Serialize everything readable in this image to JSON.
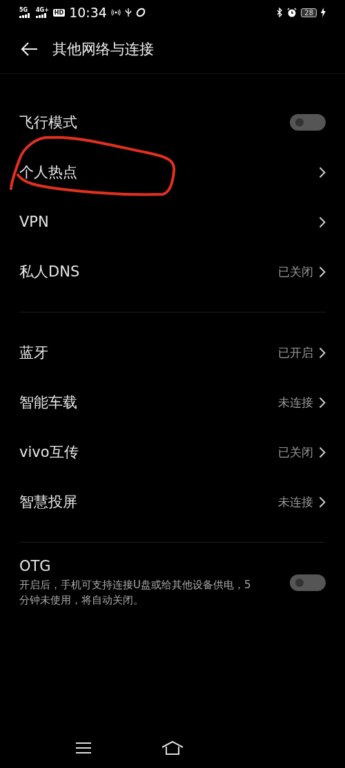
{
  "status_bar": {
    "signal_labels": [
      "5G",
      "4G+"
    ],
    "hd": "HD",
    "time": "10:34",
    "battery": "28"
  },
  "header": {
    "title": "其他网络与连接"
  },
  "sections": [
    {
      "items": [
        {
          "kind": "toggle",
          "label": "飞行模式",
          "on": false,
          "highlighted": false
        },
        {
          "kind": "link",
          "label": "个人热点",
          "highlighted": true
        },
        {
          "kind": "link",
          "label": "VPN",
          "highlighted": false
        },
        {
          "kind": "link",
          "label": "私人DNS",
          "value": "已关闭",
          "highlighted": false
        }
      ]
    },
    {
      "items": [
        {
          "kind": "link",
          "label": "蓝牙",
          "value": "已开启",
          "highlighted": false
        },
        {
          "kind": "link",
          "label": "智能车载",
          "value": "未连接",
          "highlighted": false
        },
        {
          "kind": "link",
          "label": "vivo互传",
          "value": "已关闭",
          "highlighted": false
        },
        {
          "kind": "link",
          "label": "智慧投屏",
          "value": "未连接",
          "highlighted": false
        }
      ]
    },
    {
      "items": [
        {
          "kind": "toggle",
          "label": "OTG",
          "description": "开启后，手机可支持连接U盘或给其他设备供电，5分钟未使用，将自动关闭。",
          "on": false,
          "highlighted": false
        }
      ]
    }
  ]
}
